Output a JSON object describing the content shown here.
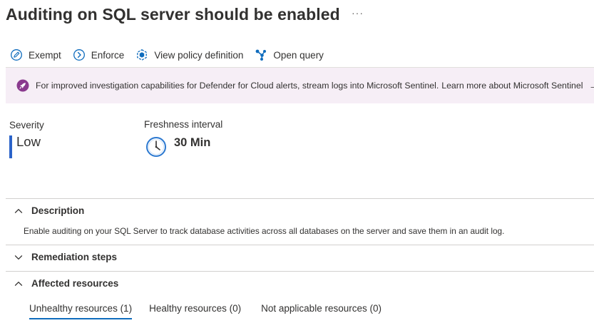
{
  "header": {
    "title": "Auditing on SQL server should be enabled",
    "more_label": "···"
  },
  "toolbar": {
    "exempt_label": "Exempt",
    "enforce_label": "Enforce",
    "view_policy_label": "View policy definition",
    "open_query_label": "Open query"
  },
  "banner": {
    "text": "For improved investigation capabilities for Defender for Cloud alerts, stream logs into Microsoft Sentinel.",
    "link_label": "Learn more about Microsoft Sentinel",
    "arrow": "→"
  },
  "severity": {
    "label": "Severity",
    "value": "Low",
    "color": "#2b63c9"
  },
  "freshness": {
    "label": "Freshness interval",
    "value": "30 Min"
  },
  "sections": {
    "description": {
      "title": "Description",
      "expanded": true,
      "text": "Enable auditing on your SQL Server to track database activities across all databases on the server and save them in an audit log."
    },
    "remediation": {
      "title": "Remediation steps",
      "expanded": false
    },
    "affected": {
      "title": "Affected resources",
      "expanded": true
    }
  },
  "tabs": [
    {
      "label": "Unhealthy resources (1)",
      "active": true
    },
    {
      "label": "Healthy resources (0)",
      "active": false
    },
    {
      "label": "Not applicable resources (0)",
      "active": false
    }
  ],
  "colors": {
    "accent": "#0f6cbd",
    "banner_bg": "#f6eef6",
    "banner_icon": "#8a3a8e"
  }
}
